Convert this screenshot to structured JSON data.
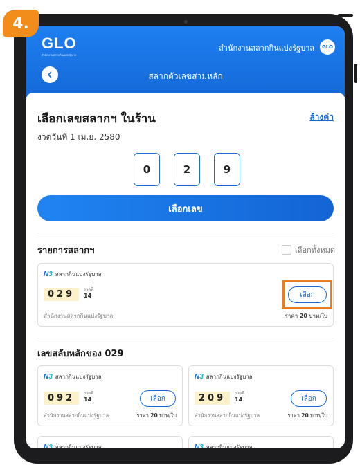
{
  "step_badge": "4.",
  "header": {
    "logo_text": "GLO",
    "logo_subtitle": "สำนักงานสลากกินแบ่งรัฐบาล",
    "org_name": "สำนักงานสลากกินแบ่งรัฐบาล",
    "avatar_text": "GLO",
    "page_title": "สลากตัวเลขสามหลัก"
  },
  "selection": {
    "title": "เลือกเลขสลากฯ ในร้าน",
    "clear_label": "ล้างค่า",
    "draw_date": "งวดวันที่ 1 เม.ย. 2580",
    "digits": [
      "0",
      "2",
      "9"
    ],
    "choose_button": "เลือกเลข"
  },
  "ticket_list": {
    "title": "รายการสลากฯ",
    "select_all_label": "เลือกทั้งหมด"
  },
  "ticket_common": {
    "brand_logo": "N3",
    "brand_name": "สลากกินแบ่งรัฐบาล",
    "period_label": "งวดที่",
    "period_value": "14",
    "org": "สำนักงานสลากกินแบ่งรัฐบาล",
    "price_prefix": "ราคา",
    "price_value": "20",
    "price_suffix": "บาท/ใบ",
    "select_label": "เลือก"
  },
  "main_ticket": {
    "number": "029"
  },
  "permutations": {
    "title": "เลขสลับหลักของ 029",
    "tickets": [
      {
        "number": "092"
      },
      {
        "number": "209"
      }
    ]
  },
  "colors": {
    "primary": "#1569d8",
    "highlight": "#f07b1a",
    "badge": "#f28c1b",
    "number_bg": "#fdf1c9"
  }
}
